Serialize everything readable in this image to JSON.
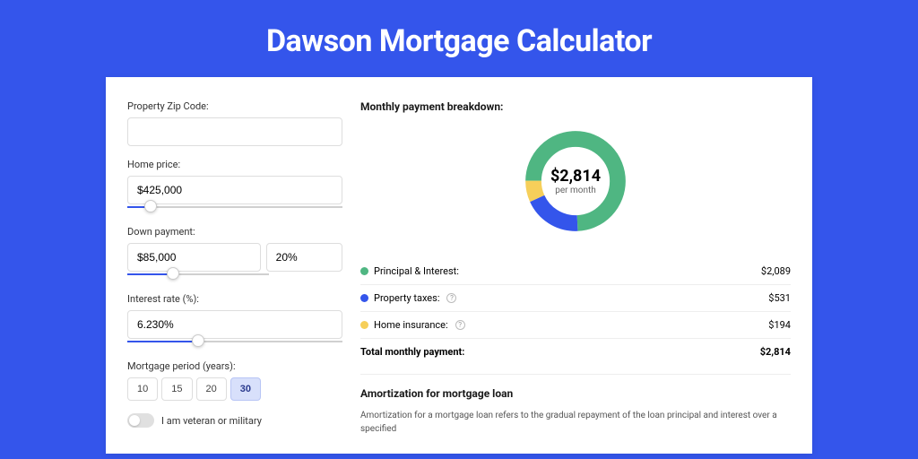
{
  "title": "Dawson Mortgage Calculator",
  "form": {
    "zip_label": "Property Zip Code:",
    "home_price_label": "Home price:",
    "home_price_value": "$425,000",
    "down_payment_label": "Down payment:",
    "down_payment_value": "$85,000",
    "down_payment_pct": "20%",
    "interest_label": "Interest rate (%):",
    "interest_value": "6.230%",
    "period_label": "Mortgage period (years):",
    "periods": [
      "10",
      "15",
      "20",
      "30"
    ],
    "period_active": "30",
    "veteran_label": "I am veteran or military"
  },
  "breakdown": {
    "title": "Monthly payment breakdown:",
    "donut_amount": "$2,814",
    "donut_per": "per month",
    "items": [
      {
        "label": "Principal & Interest:",
        "amount": "$2,089",
        "color": "#4fb682"
      },
      {
        "label": "Property taxes:",
        "amount": "$531",
        "color": "#3455eb",
        "info": true
      },
      {
        "label": "Home insurance:",
        "amount": "$194",
        "color": "#f6cf5a",
        "info": true
      }
    ],
    "total_label": "Total monthly payment:",
    "total_amount": "$2,814"
  },
  "amort": {
    "title": "Amortization for mortgage loan",
    "text": "Amortization for a mortgage loan refers to the gradual repayment of the loan principal and interest over a specified"
  },
  "chart_data": {
    "type": "pie",
    "title": "Monthly payment breakdown",
    "total": 2814,
    "unit": "USD per month",
    "series": [
      {
        "name": "Principal & Interest",
        "value": 2089,
        "color": "#4fb682"
      },
      {
        "name": "Property taxes",
        "value": 531,
        "color": "#3455eb"
      },
      {
        "name": "Home insurance",
        "value": 194,
        "color": "#f6cf5a"
      }
    ]
  }
}
